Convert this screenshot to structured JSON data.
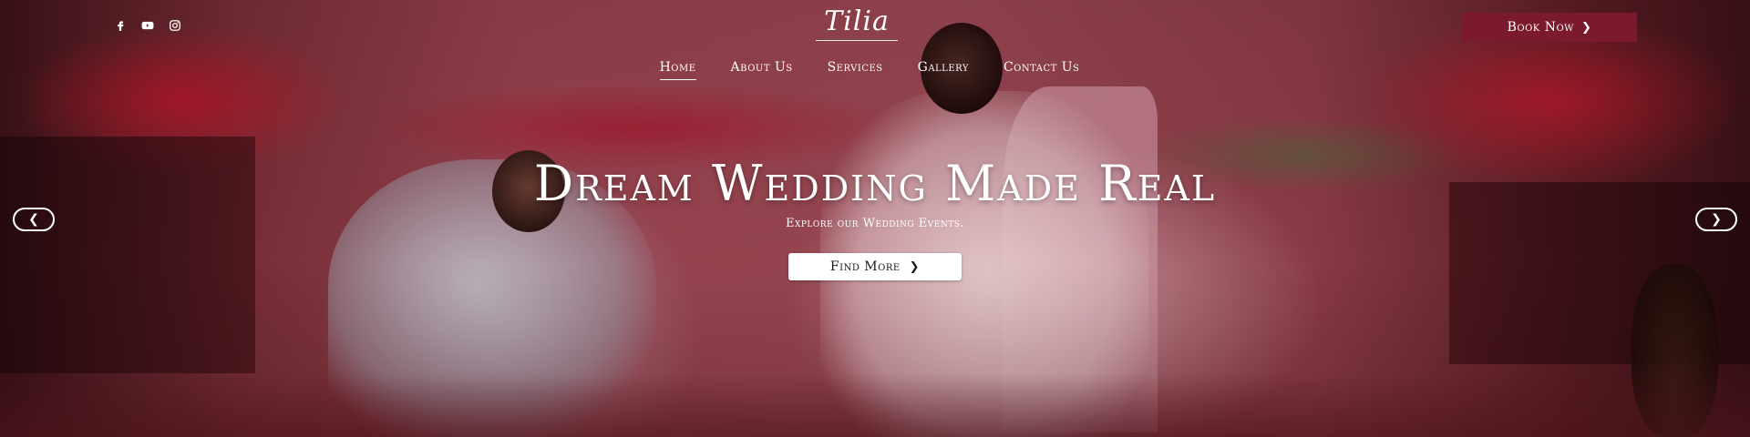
{
  "brand": {
    "logo_text": "Tilia"
  },
  "social": [
    {
      "icon": "facebook-icon"
    },
    {
      "icon": "youtube-icon"
    },
    {
      "icon": "instagram-icon"
    }
  ],
  "nav": {
    "items": [
      {
        "label": "Home",
        "active": true
      },
      {
        "label": "About Us"
      },
      {
        "label": "Services"
      },
      {
        "label": "Gallery"
      },
      {
        "label": "Contact Us"
      }
    ]
  },
  "header": {
    "book_label": "Book Now",
    "book_icon": "chevron-right-icon",
    "book_color": "#7a1a2c"
  },
  "hero": {
    "title": "Dream Wedding Made Real",
    "subtitle": "Explore our Wedding Events.",
    "cta_label": "Find More",
    "cta_icon": "chevron-right-icon",
    "prev_icon": "chevron-left-icon",
    "next_icon": "chevron-right-icon"
  }
}
